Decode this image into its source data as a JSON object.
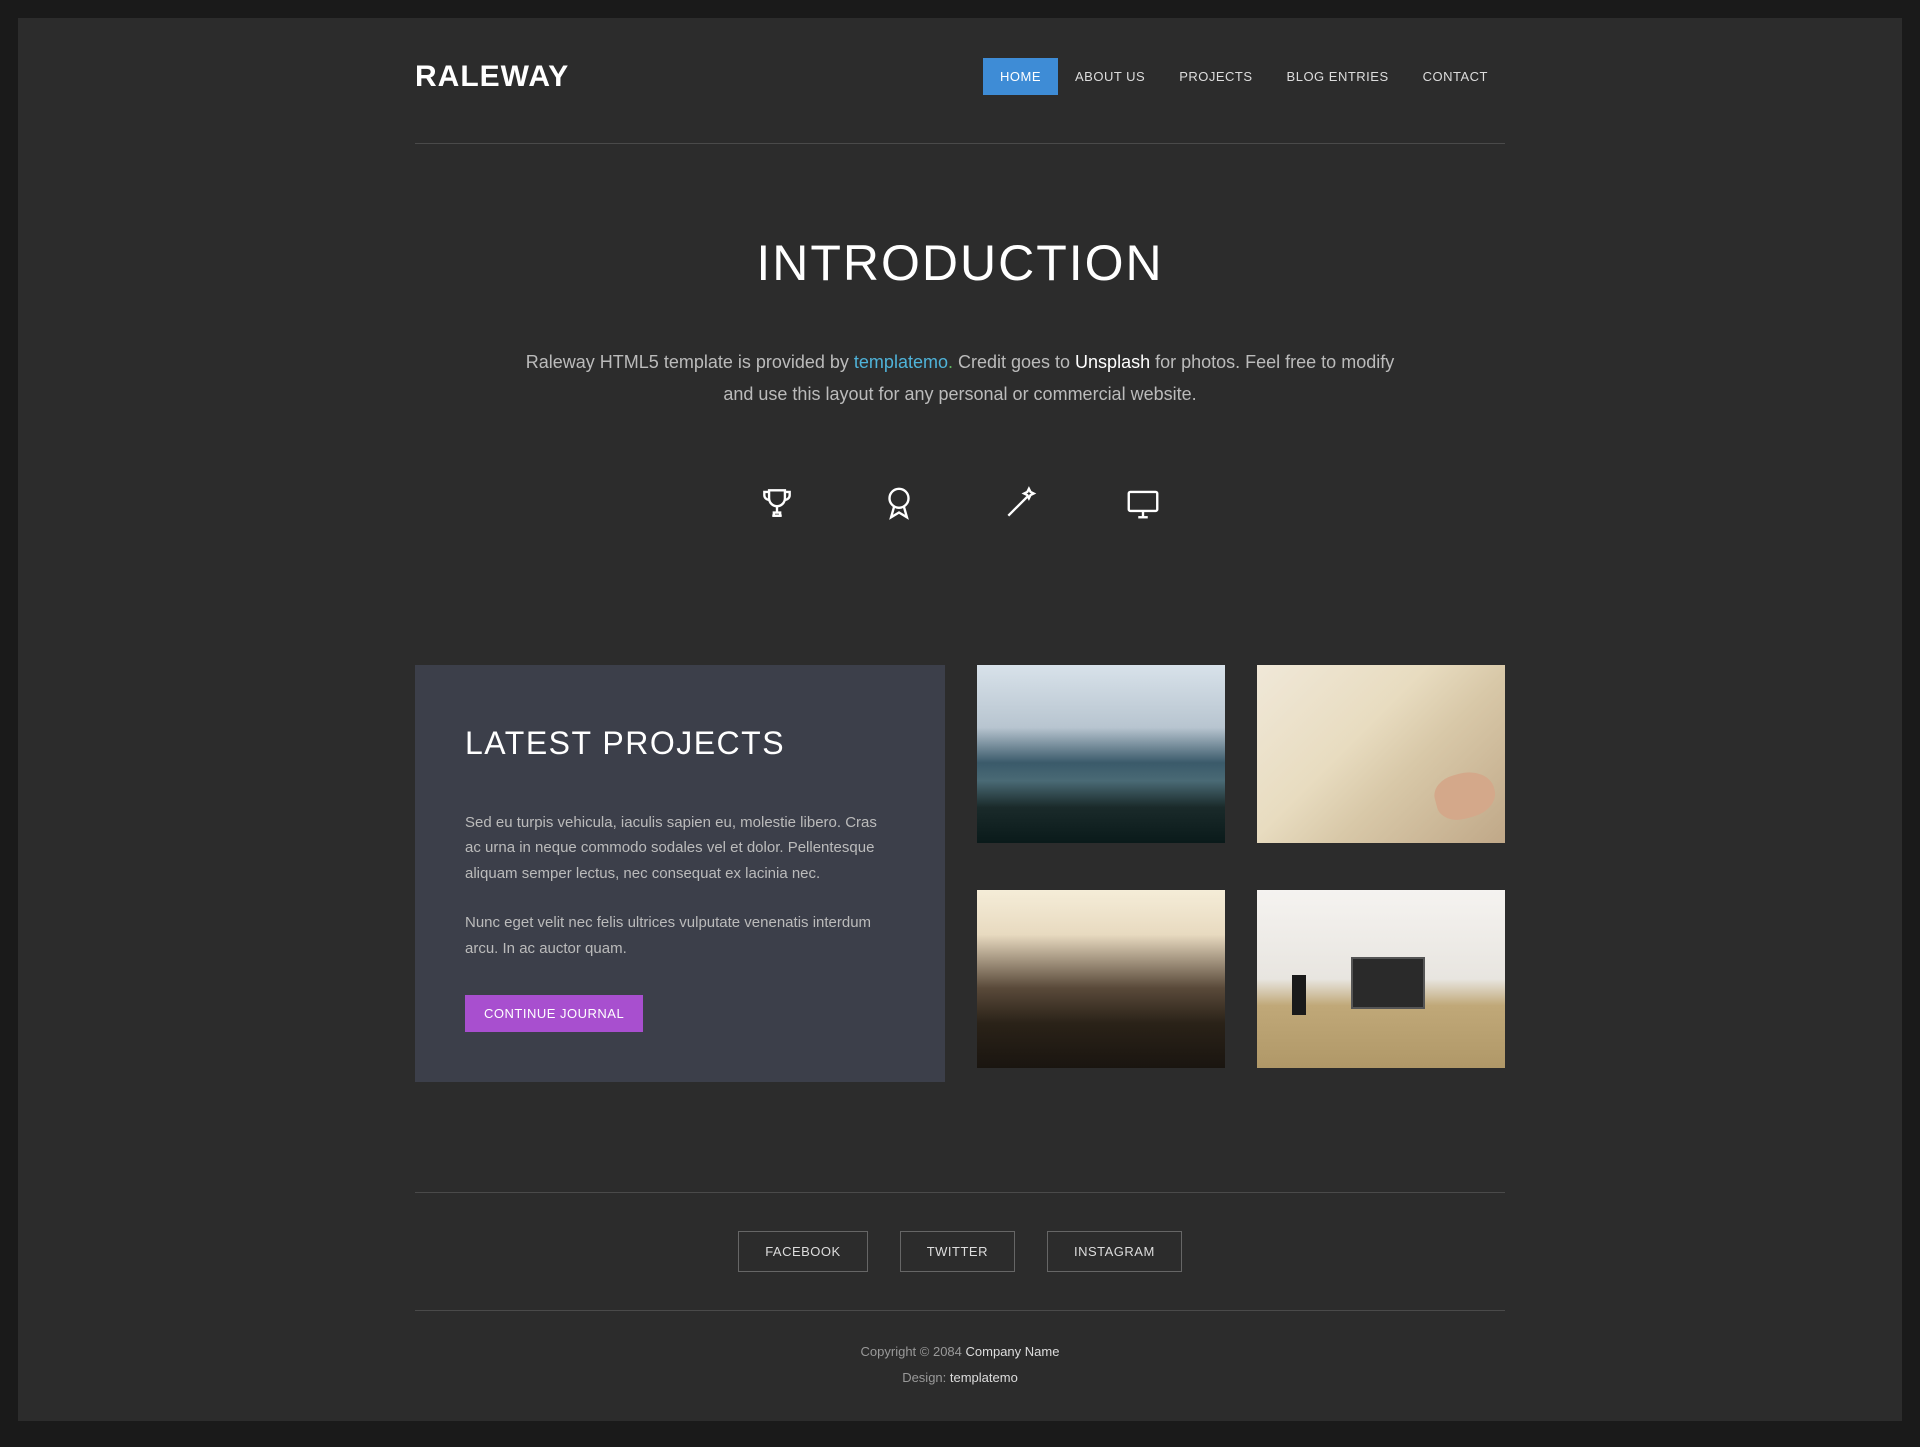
{
  "logo": "RALEWAY",
  "nav": [
    {
      "label": "HOME",
      "active": true
    },
    {
      "label": "ABOUT US",
      "active": false
    },
    {
      "label": "PROJECTS",
      "active": false
    },
    {
      "label": "BLOG ENTRIES",
      "active": false
    },
    {
      "label": "CONTACT",
      "active": false
    }
  ],
  "intro": {
    "title": "INTRODUCTION",
    "text_pre": "Raleway HTML5 template is provided by ",
    "link_tm": "templatemo",
    "dot": ".",
    "text_mid": " Credit goes to ",
    "link_un": "Unsplash",
    "text_post": " for photos. Feel free to modify and use this layout for any personal or commercial website."
  },
  "icons": [
    "trophy-icon",
    "badge-icon",
    "wand-icon",
    "monitor-icon"
  ],
  "projects": {
    "title": "LATEST PROJECTS",
    "p1": "Sed eu turpis vehicula, iaculis sapien eu, molestie libero. Cras ac urna in neque commodo sodales vel et dolor. Pellentesque aliquam semper lectus, nec consequat ex lacinia nec.",
    "p2": "Nunc eget velit nec felis ultrices vulputate venenatis interdum arcu. In ac auctor quam.",
    "button": "CONTINUE JOURNAL"
  },
  "social": [
    {
      "label": "FACEBOOK"
    },
    {
      "label": "TWITTER"
    },
    {
      "label": "INSTAGRAM"
    }
  ],
  "footer": {
    "copyright_pre": "Copyright © 2084 ",
    "company": "Company Name",
    "design_pre": "Design: ",
    "design_link": "templatemo"
  }
}
